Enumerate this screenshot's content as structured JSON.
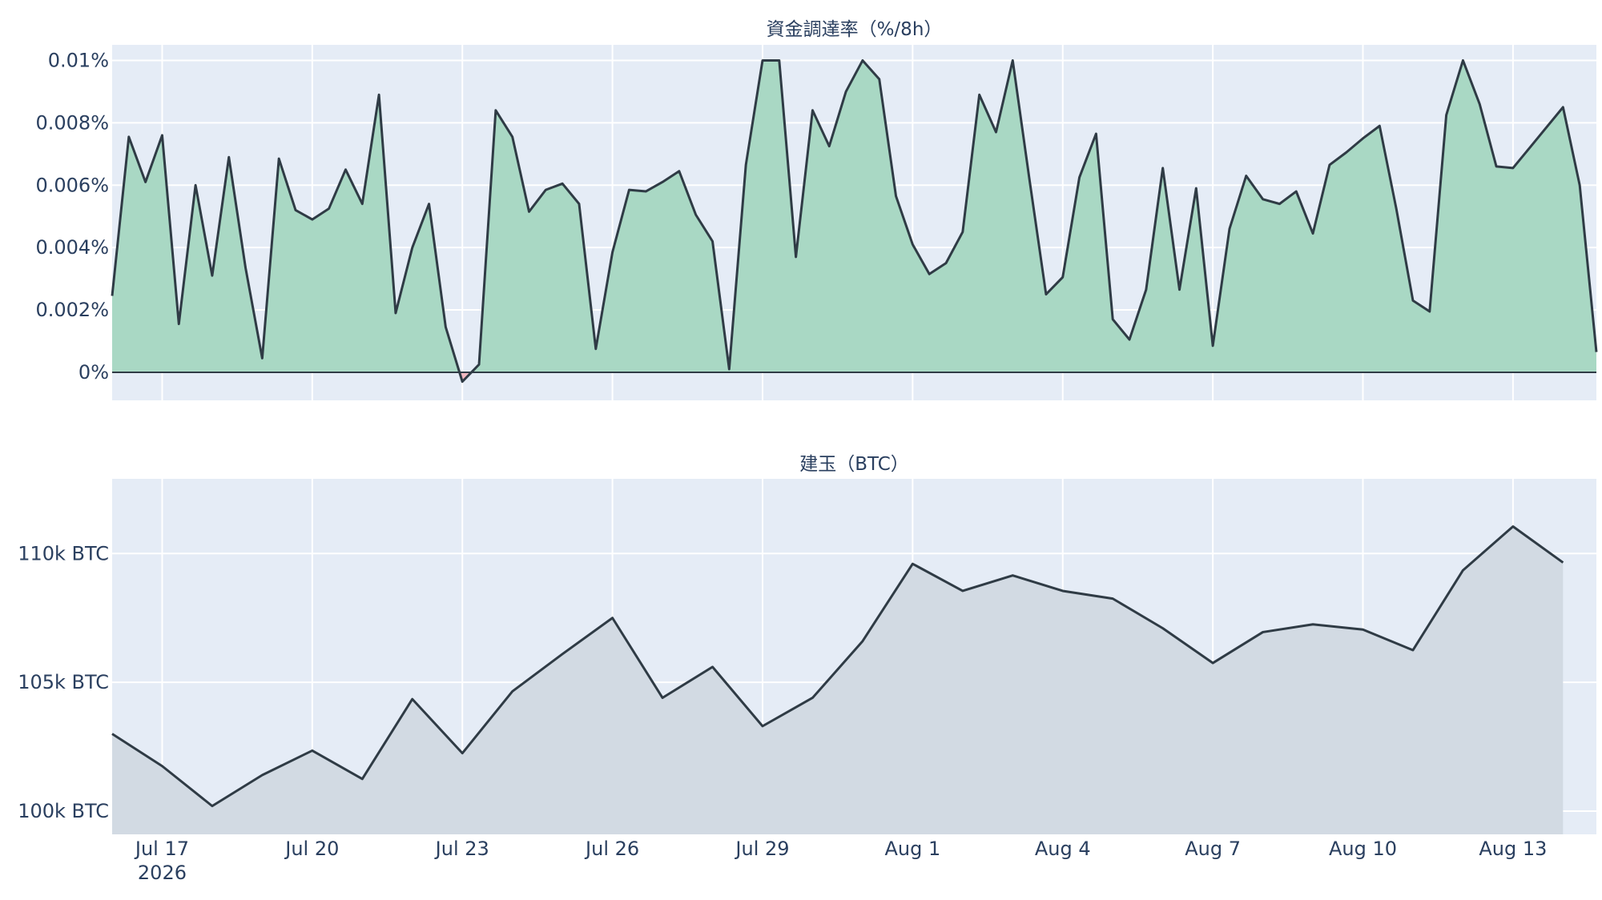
{
  "x_ticks": [
    "Jul 17",
    "Jul 20",
    "Jul 23",
    "Jul 26",
    "Jul 29",
    "Aug 1",
    "Aug 4",
    "Aug 7",
    "Aug 10",
    "Aug 13"
  ],
  "x_year": "2026",
  "colors": {
    "plot_bg": "#e5ecf6",
    "grid": "#ffffff",
    "line": "#2f3b45",
    "funding_fill_pos": "#a9d8c4",
    "funding_fill_neg": "#f2b8c0",
    "oi_fill": "#d2dae3",
    "text": "#2a3f5f"
  },
  "chart_data": [
    {
      "type": "area",
      "title": "資金調達率（%/8h）",
      "x_unit": "date",
      "x_range": [
        "2026-07-16 00:00",
        "2026-08-14 16:00"
      ],
      "ylim": [
        -0.0009,
        0.0105
      ],
      "yticks": [
        0,
        0.002,
        0.004,
        0.006,
        0.008,
        0.01
      ],
      "ytick_labels": [
        "0%",
        "0.002%",
        "0.004%",
        "0.006%",
        "0.008%",
        "0.01%"
      ],
      "grid": true,
      "zero_line": true,
      "x": [
        "2026-07-16 00:00",
        "2026-07-16 08:00",
        "2026-07-16 16:00",
        "2026-07-17 00:00",
        "2026-07-17 08:00",
        "2026-07-17 16:00",
        "2026-07-18 00:00",
        "2026-07-18 08:00",
        "2026-07-18 16:00",
        "2026-07-19 00:00",
        "2026-07-19 08:00",
        "2026-07-19 16:00",
        "2026-07-20 00:00",
        "2026-07-20 08:00",
        "2026-07-20 16:00",
        "2026-07-21 00:00",
        "2026-07-21 08:00",
        "2026-07-21 16:00",
        "2026-07-22 00:00",
        "2026-07-22 08:00",
        "2026-07-22 16:00",
        "2026-07-23 00:00",
        "2026-07-23 08:00",
        "2026-07-23 16:00",
        "2026-07-24 00:00",
        "2026-07-24 08:00",
        "2026-07-24 16:00",
        "2026-07-25 00:00",
        "2026-07-25 08:00",
        "2026-07-25 16:00",
        "2026-07-26 00:00",
        "2026-07-26 08:00",
        "2026-07-26 16:00",
        "2026-07-27 00:00",
        "2026-07-27 08:00",
        "2026-07-27 16:00",
        "2026-07-28 00:00",
        "2026-07-28 08:00",
        "2026-07-28 16:00",
        "2026-07-29 00:00",
        "2026-07-29 08:00",
        "2026-07-29 16:00",
        "2026-07-30 00:00",
        "2026-07-30 08:00",
        "2026-07-30 16:00",
        "2026-07-31 00:00",
        "2026-07-31 08:00",
        "2026-07-31 16:00",
        "2026-08-01 00:00",
        "2026-08-01 08:00",
        "2026-08-01 16:00",
        "2026-08-02 00:00",
        "2026-08-02 08:00",
        "2026-08-02 16:00",
        "2026-08-03 00:00",
        "2026-08-03 08:00",
        "2026-08-03 16:00",
        "2026-08-04 00:00",
        "2026-08-04 08:00",
        "2026-08-04 16:00",
        "2026-08-05 00:00",
        "2026-08-05 08:00",
        "2026-08-05 16:00",
        "2026-08-06 00:00",
        "2026-08-06 08:00",
        "2026-08-06 16:00",
        "2026-08-07 00:00",
        "2026-08-07 08:00",
        "2026-08-07 16:00",
        "2026-08-08 00:00",
        "2026-08-08 08:00",
        "2026-08-08 16:00",
        "2026-08-09 00:00",
        "2026-08-09 08:00",
        "2026-08-09 16:00",
        "2026-08-10 00:00",
        "2026-08-10 08:00",
        "2026-08-10 16:00",
        "2026-08-11 00:00",
        "2026-08-11 08:00",
        "2026-08-11 16:00",
        "2026-08-12 00:00",
        "2026-08-12 08:00",
        "2026-08-12 16:00",
        "2026-08-13 00:00",
        "2026-08-13 08:00",
        "2026-08-13 16:00",
        "2026-08-14 00:00",
        "2026-08-14 08:00",
        "2026-08-14 16:00"
      ],
      "values": [
        0.00245,
        0.00755,
        0.0061,
        0.0076,
        0.00155,
        0.006,
        0.0031,
        0.0069,
        0.00335,
        0.00045,
        0.00685,
        0.0052,
        0.0049,
        0.00525,
        0.0065,
        0.0054,
        0.0089,
        0.0019,
        0.004,
        0.0054,
        0.00145,
        -0.0003,
        0.00025,
        0.0084,
        0.00755,
        0.00515,
        0.00585,
        0.00605,
        0.0054,
        0.00075,
        0.00385,
        0.00585,
        0.0058,
        0.0061,
        0.00645,
        0.00505,
        0.0042,
        0.0001,
        0.00665,
        0.01,
        0.01,
        0.0037,
        0.0084,
        0.00725,
        0.009,
        0.01,
        0.0094,
        0.00565,
        0.0041,
        0.00315,
        0.0035,
        0.0045,
        0.0089,
        0.0077,
        0.01,
        0.0062,
        0.0025,
        0.00305,
        0.00625,
        0.00765,
        0.0017,
        0.00105,
        0.00265,
        0.00655,
        0.00265,
        0.0059,
        0.00085,
        0.0046,
        0.0063,
        0.00555,
        0.0054,
        0.0058,
        0.00445,
        0.00665,
        0.00705,
        0.0075,
        0.0079,
        0.00525,
        0.0023,
        0.00195,
        0.00825,
        0.01,
        0.0086,
        0.0066,
        0.00655,
        0.0072,
        0.00785,
        0.0085,
        0.006,
        0.00065
      ]
    },
    {
      "type": "area",
      "title": "建玉（BTC）",
      "x_unit": "date",
      "x_range": [
        "2026-07-16 00:00",
        "2026-08-14 16:00"
      ],
      "ylim": [
        99100,
        112900
      ],
      "yticks": [
        100000,
        105000,
        110000
      ],
      "ytick_labels": [
        "100k BTC",
        "105k BTC",
        "110k BTC"
      ],
      "grid": true,
      "x": [
        "2026-07-16",
        "2026-07-17",
        "2026-07-18",
        "2026-07-19",
        "2026-07-20",
        "2026-07-21",
        "2026-07-22",
        "2026-07-23",
        "2026-07-24",
        "2026-07-25",
        "2026-07-26",
        "2026-07-27",
        "2026-07-28",
        "2026-07-29",
        "2026-07-30",
        "2026-07-31",
        "2026-08-01",
        "2026-08-02",
        "2026-08-03",
        "2026-08-04",
        "2026-08-05",
        "2026-08-06",
        "2026-08-07",
        "2026-08-08",
        "2026-08-09",
        "2026-08-10",
        "2026-08-11",
        "2026-08-12",
        "2026-08-13",
        "2026-08-14"
      ],
      "values": [
        103000,
        101750,
        100200,
        101400,
        102350,
        101250,
        104350,
        102250,
        104650,
        106100,
        107500,
        104400,
        105600,
        103300,
        104400,
        106600,
        109600,
        108550,
        109150,
        108550,
        108250,
        107100,
        105750,
        106950,
        107250,
        107050,
        106250,
        109350,
        111050,
        109650
      ]
    }
  ]
}
